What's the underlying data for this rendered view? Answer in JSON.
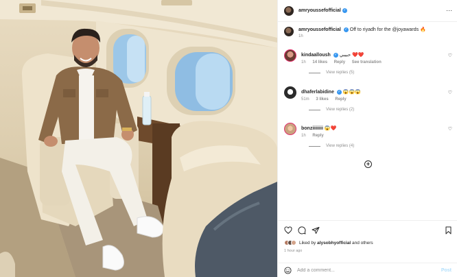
{
  "post": {
    "username": "amryoussefofficial",
    "caption": "Off to riyadh for the @joyawards",
    "caption_emoji": "🔥",
    "caption_time": "1h",
    "menu_glyph": "···"
  },
  "comments": [
    {
      "username": "kindaalloush",
      "verified": true,
      "text": "حبيبي ❤️❤️",
      "time": "1h",
      "likes": "14 likes",
      "reply": "Reply",
      "extra": "See translation",
      "view_replies": "View replies (5)"
    },
    {
      "username": "dhaferlabidine",
      "verified": true,
      "text": "😱😱😱",
      "time": "51m",
      "likes": "3 likes",
      "reply": "Reply",
      "extra": "",
      "view_replies": "View replies (2)"
    },
    {
      "username": "bonziiiiiiii",
      "verified": false,
      "text": "😱❤️",
      "time": "1h",
      "likes": "",
      "reply": "Reply",
      "extra": "",
      "view_replies": "View replies (4)"
    }
  ],
  "load_more_glyph": "+",
  "likes": {
    "prefix": "Liked by ",
    "user": "alysobhyofficial",
    "suffix": " and others"
  },
  "post_age": "1 hour ago",
  "comment_box": {
    "placeholder": "Add a comment...",
    "post_label": "Post"
  },
  "icons": {
    "like": "heart-icon",
    "comment": "comment-icon",
    "share": "share-icon",
    "save": "bookmark-icon",
    "emoji": "emoji-icon"
  },
  "colors": {
    "verified": "#3797f0",
    "text": "#262626",
    "muted": "#8e8e8e",
    "post_disabled": "#b2dffc"
  }
}
